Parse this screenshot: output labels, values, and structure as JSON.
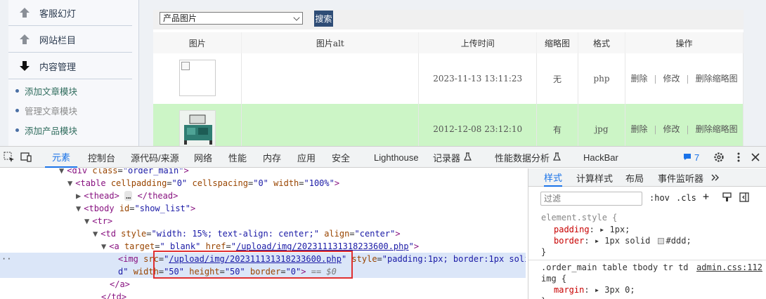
{
  "sidebar": {
    "headers": [
      {
        "label": "客服幻灯",
        "icon": "up-arrow-icon"
      },
      {
        "label": "网站栏目",
        "icon": "up-arrow-icon"
      },
      {
        "label": "内容管理",
        "icon": "down-arrow-icon"
      }
    ],
    "items": [
      {
        "label": "添加文章模块"
      },
      {
        "label": "管理文章模块"
      },
      {
        "label": "添加产品模块"
      }
    ]
  },
  "toolbar": {
    "select_value": "产品图片",
    "search_label": "搜索"
  },
  "table": {
    "headers": [
      "图片",
      "图片alt",
      "上传时间",
      "缩略图",
      "格式",
      "操作"
    ],
    "rows": [
      {
        "alt": "",
        "time": "2023-11-13 13:11:23",
        "thumb": "无",
        "format": "php",
        "ops": [
          "删除",
          "修改",
          "删除缩略图"
        ]
      },
      {
        "alt": "",
        "time": "2012-12-08 23:12:10",
        "thumb": "有",
        "format": "jpg",
        "ops": [
          "删除",
          "修改",
          "删除缩略图"
        ]
      }
    ]
  },
  "devtools": {
    "tabs": [
      "元素",
      "控制台",
      "源代码/来源",
      "网络",
      "性能",
      "内存",
      "应用",
      "安全",
      "Lighthouse",
      "记录器",
      "性能数据分析",
      "HackBar"
    ],
    "issues_count": "7",
    "elements": {
      "l1": {
        "tag": "div",
        "attr": "class",
        "val": "order_main"
      },
      "l2": {
        "tag": "table",
        "a1": "cellpadding",
        "v1": "0",
        "a2": "cellspacing",
        "v2": "0",
        "a3": "width",
        "v3": "100%"
      },
      "l3": {
        "tag": "thead",
        "ellipsis": "…"
      },
      "l4": {
        "tag": "tbody",
        "attr": "id",
        "val": "show_list"
      },
      "l5": {
        "tag": "tr"
      },
      "l6": {
        "tag": "td",
        "a1": "style",
        "v1": "width: 15%; text-align: center;",
        "a2": "align",
        "v2": "center"
      },
      "l7": {
        "tag": "a",
        "a1": "target",
        "v1": "_blank",
        "a2": "href",
        "v2": "/upload/img/202311131318233600.php"
      },
      "l8": {
        "tag": "img",
        "a1": "src",
        "v1": "/upload/img/202311131318233600.php",
        "a2": "style",
        "v2a": "padding:1px; border:1px solid #dd",
        "v2b": "d",
        "a3": "width",
        "v3": "50",
        "a4": "height",
        "v4": "50",
        "a5": "border",
        "v5": "0",
        "suffix": "== $0"
      },
      "l9": "</a>",
      "l10": "</td>"
    },
    "styles": {
      "tabs": [
        "样式",
        "计算样式",
        "布局",
        "事件监听器"
      ],
      "filter_placeholder": "过滤",
      "hov": ":hov",
      "cls": ".cls",
      "rule1_selector": "element.style {",
      "rule1_prop1": "padding",
      "rule1_val1": "1px;",
      "rule1_prop2": "border",
      "rule1_val2a": "1px solid",
      "rule1_val2b": "#ddd;",
      "close": "}",
      "rule2_selector": ".order_main table tbody tr td",
      "rule2_selector2": "img {",
      "rule2_source": "admin.css:112",
      "rule2_prop": "margin",
      "rule2_val": "3px 0;"
    }
  }
}
